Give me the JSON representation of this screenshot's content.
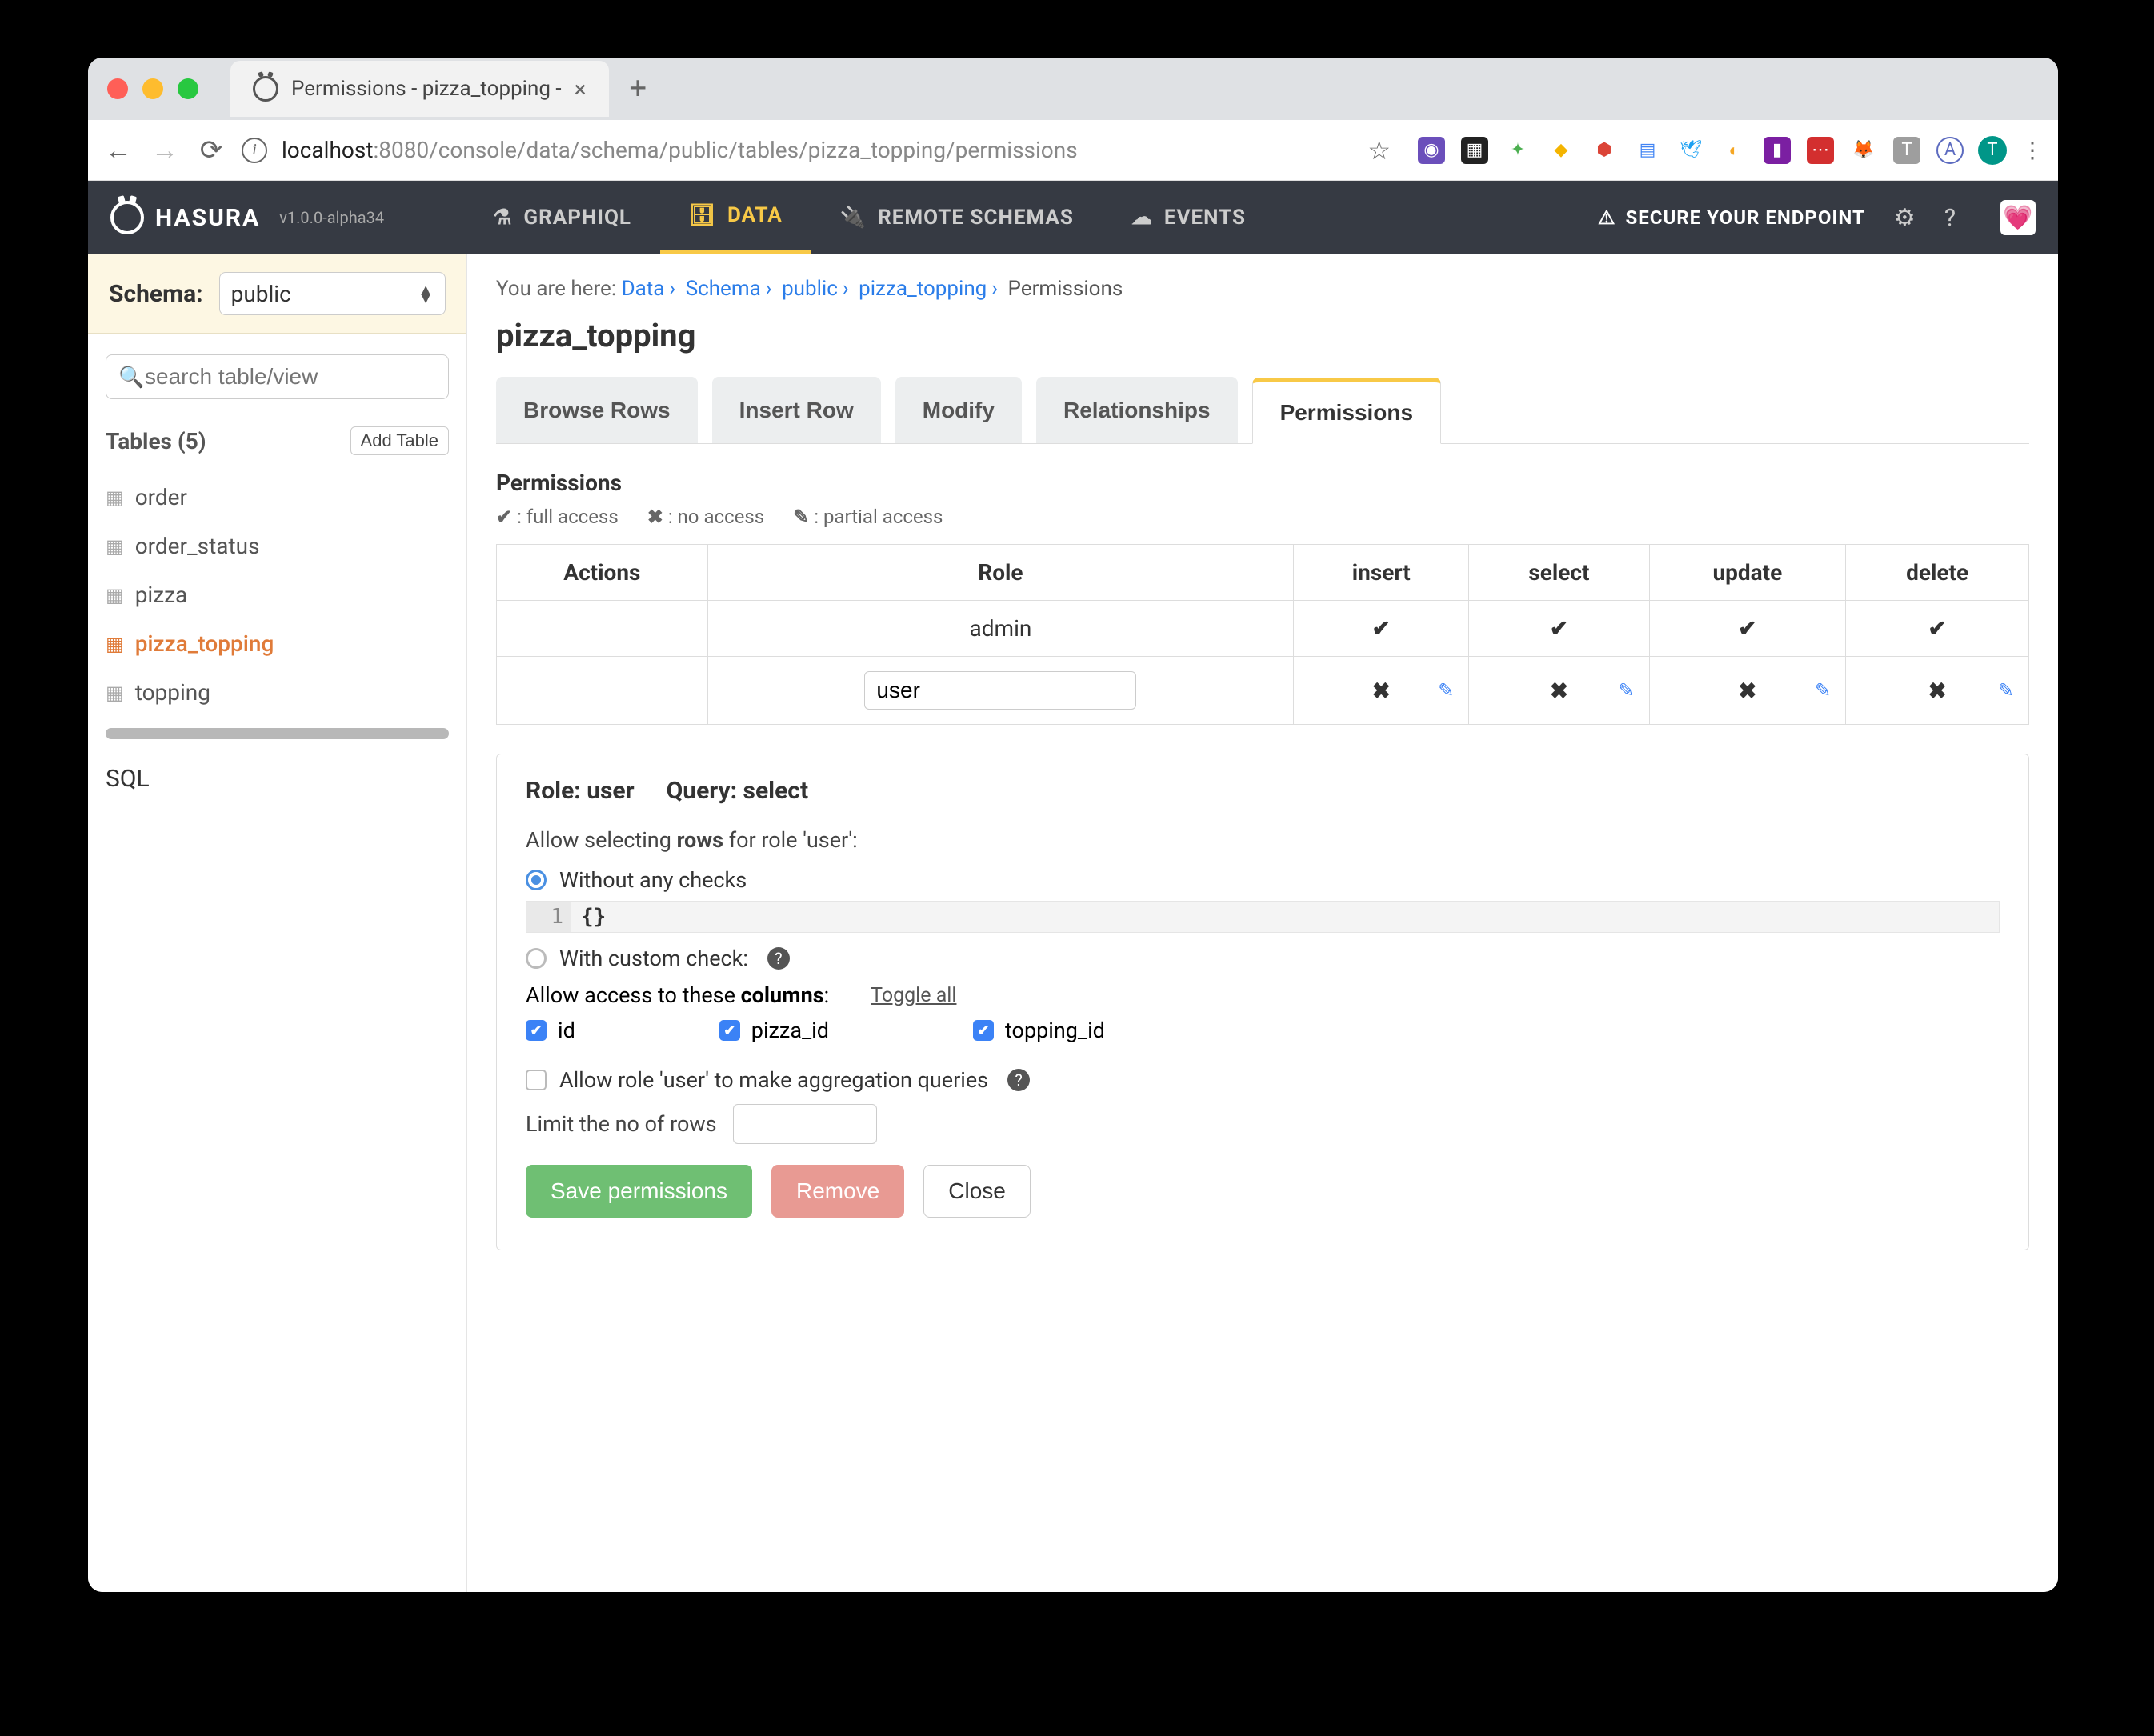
{
  "browser": {
    "tab_title": "Permissions - pizza_topping - ",
    "url_host": "localhost",
    "url_port": ":8080",
    "url_path": "/console/data/schema/public/tables/pizza_topping/permissions",
    "avatar_letter": "T"
  },
  "nav": {
    "brand": "HASURA",
    "version": "v1.0.0-alpha34",
    "links": {
      "graphiql": "GRAPHIQL",
      "data": "DATA",
      "remote_schemas": "REMOTE SCHEMAS",
      "events": "EVENTS"
    },
    "secure": "SECURE YOUR ENDPOINT"
  },
  "sidebar": {
    "schema_label": "Schema:",
    "schema_value": "public",
    "search_placeholder": "search table/view",
    "tables_header": "Tables (5)",
    "add_table": "Add Table",
    "items": [
      {
        "label": "order"
      },
      {
        "label": "order_status"
      },
      {
        "label": "pizza"
      },
      {
        "label": "pizza_topping"
      },
      {
        "label": "topping"
      }
    ],
    "sql": "SQL"
  },
  "breadcrumb": {
    "prefix": "You are here: ",
    "data": "Data",
    "schema": "Schema",
    "public": "public",
    "table": "pizza_topping",
    "current": "Permissions"
  },
  "table_name": "pizza_topping",
  "tabs": {
    "browse": "Browse Rows",
    "insert": "Insert Row",
    "modify": "Modify",
    "relationships": "Relationships",
    "permissions": "Permissions"
  },
  "permissions": {
    "header": "Permissions",
    "legend_full": ": full access",
    "legend_none": ": no access",
    "legend_partial": ": partial access",
    "th_actions": "Actions",
    "th_role": "Role",
    "th_insert": "insert",
    "th_select": "select",
    "th_update": "update",
    "th_delete": "delete",
    "admin_role": "admin",
    "user_role_value": "user"
  },
  "panel": {
    "role_label": "Role: user",
    "query_label": "Query: select",
    "allow_rows_pre": "Allow selecting ",
    "allow_rows_strong": "rows",
    "allow_rows_post": " for role 'user':",
    "opt_without": "Without any checks",
    "code_line": "1",
    "code_body": "{}",
    "opt_custom": "With custom check:",
    "allow_cols_pre": "Allow access to these ",
    "allow_cols_strong": "columns",
    "allow_cols_post": ":",
    "toggle_all": "Toggle all",
    "col_id": "id",
    "col_pizza_id": "pizza_id",
    "col_topping_id": "topping_id",
    "agg_label": "Allow role 'user' to make aggregation queries",
    "limit_label": "Limit the no of rows",
    "save": "Save permissions",
    "remove": "Remove",
    "close": "Close"
  }
}
